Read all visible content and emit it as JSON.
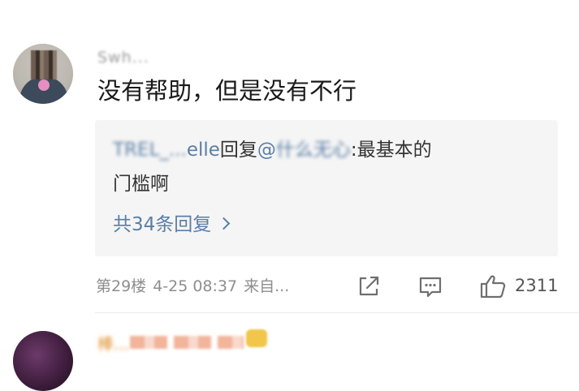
{
  "comment": {
    "username": "Swh...",
    "text": "没有帮助，但是没有不行",
    "reply": {
      "author_prefix": "TREL_...",
      "author_suffix": "elle",
      "verb": "回复",
      "mention_at": "@",
      "mention_name": "什么无心",
      "colon": ":",
      "text_line1": "最基本的",
      "text_line2": "门槛啊"
    },
    "more_replies": "共34条回复",
    "floor": "第29楼",
    "datetime": "4-25 08:37",
    "source": "来自...",
    "like_count": "2311"
  },
  "next_comment": {
    "username": "棒..."
  },
  "icons": {
    "share": "share-edit-icon",
    "comment": "comment-bubble-icon",
    "like": "thumbs-up-icon",
    "more_chevron": "chevron-right-icon"
  },
  "colors": {
    "link": "#5a7ea6",
    "meta": "#8e8e8e",
    "reply_bg": "#f5f5f5",
    "vip_name": "#e0912f"
  }
}
